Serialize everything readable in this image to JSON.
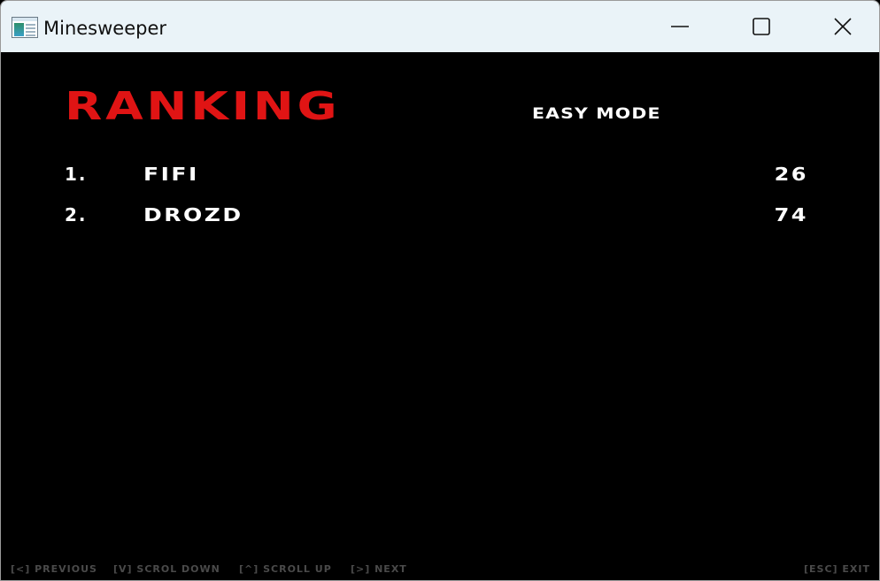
{
  "window": {
    "title": "Minesweeper",
    "icons": {
      "app": "app-window-icon",
      "minimize": "minimize-icon",
      "maximize": "maximize-icon",
      "close": "close-icon"
    }
  },
  "screen": {
    "heading": "RANKING",
    "mode": "EASY MODE",
    "colors": {
      "heading": "#e01414",
      "text": "#ffffff",
      "footer": "#4a4a4a",
      "background": "#000000"
    }
  },
  "rankings": [
    {
      "rank": "1.",
      "name": "FIFI",
      "score": "26"
    },
    {
      "rank": "2.",
      "name": "DROZD",
      "score": "74"
    }
  ],
  "footer": {
    "previous": "[<] PREVIOUS",
    "scroll_down": "[V] SCROL DOWN",
    "scroll_up": "[^] SCROLL UP",
    "next": "[>] NEXT",
    "exit": "[ESC] EXIT"
  }
}
